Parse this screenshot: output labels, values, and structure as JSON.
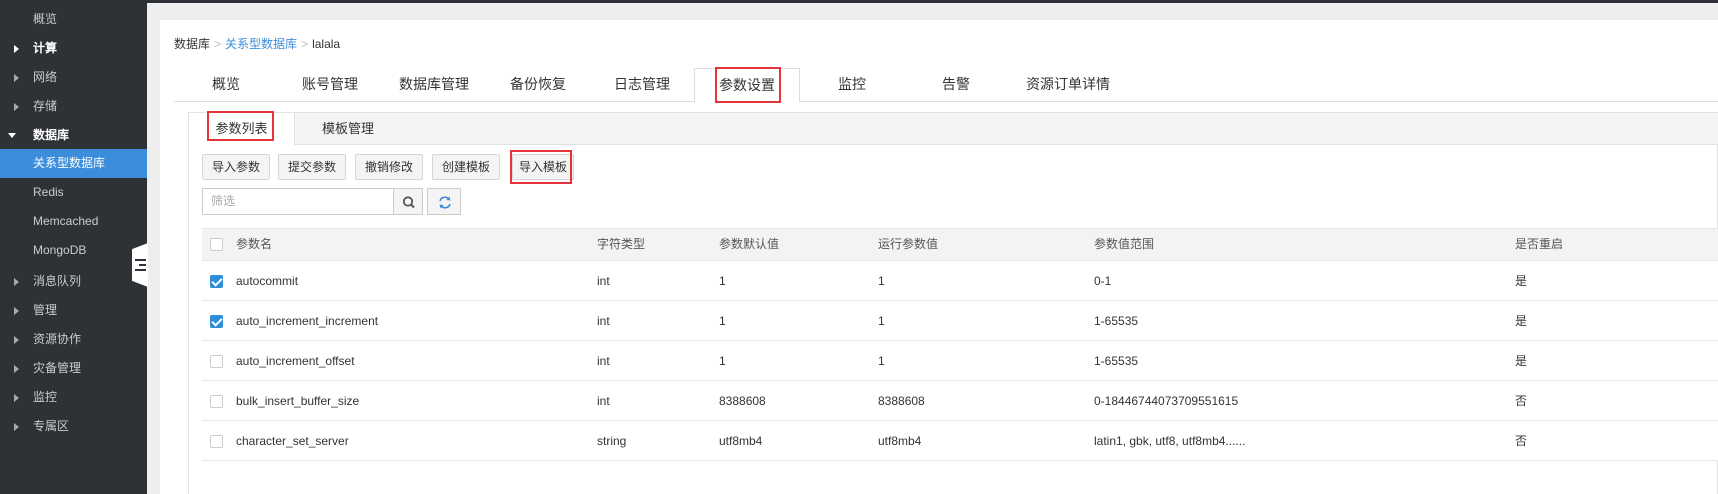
{
  "sidebar": {
    "items": [
      {
        "label": "概览"
      },
      {
        "label": "计算"
      },
      {
        "label": "网络"
      },
      {
        "label": "存储"
      },
      {
        "label": "数据库"
      },
      {
        "label": "关系型数据库"
      },
      {
        "label": "Redis"
      },
      {
        "label": "Memcached"
      },
      {
        "label": "MongoDB"
      },
      {
        "label": "消息队列"
      },
      {
        "label": "管理"
      },
      {
        "label": "资源协作"
      },
      {
        "label": "灾备管理"
      },
      {
        "label": "监控"
      },
      {
        "label": "专属区"
      }
    ]
  },
  "breadcrumb": {
    "root": "数据库",
    "section": "关系型数据库",
    "current": "lalala",
    "separator": ">"
  },
  "tabs": [
    {
      "label": "概览"
    },
    {
      "label": "账号管理"
    },
    {
      "label": "数据库管理"
    },
    {
      "label": "备份恢复"
    },
    {
      "label": "日志管理"
    },
    {
      "label": "参数设置"
    },
    {
      "label": "监控"
    },
    {
      "label": "告警"
    },
    {
      "label": "资源订单详情"
    }
  ],
  "subtabs": [
    {
      "label": "参数列表"
    },
    {
      "label": "模板管理"
    }
  ],
  "toolbar": {
    "import_params": "导入参数",
    "submit_params": "提交参数",
    "revert_changes": "撤销修改",
    "create_template": "创建模板",
    "import_template": "导入模板"
  },
  "search": {
    "placeholder": "筛选"
  },
  "table": {
    "headers": [
      "参数名",
      "字符类型",
      "参数默认值",
      "运行参数值",
      "参数值范围",
      "是否重启"
    ],
    "rows": [
      {
        "checked": true,
        "name": "autocommit",
        "type": "int",
        "default": "1",
        "running": "1",
        "range": "0-1",
        "restart": "是"
      },
      {
        "checked": true,
        "name": "auto_increment_increment",
        "type": "int",
        "default": "1",
        "running": "1",
        "range": "1-65535",
        "restart": "是"
      },
      {
        "checked": false,
        "name": "auto_increment_offset",
        "type": "int",
        "default": "1",
        "running": "1",
        "range": "1-65535",
        "restart": "是"
      },
      {
        "checked": false,
        "name": "bulk_insert_buffer_size",
        "type": "int",
        "default": "8388608",
        "running": "8388608",
        "range": "0-18446744073709551615",
        "restart": "否"
      },
      {
        "checked": false,
        "name": "character_set_server",
        "type": "string",
        "default": "utf8mb4",
        "running": "utf8mb4",
        "range": "latin1, gbk, utf8, utf8mb4......",
        "restart": "否"
      }
    ]
  },
  "colors": {
    "sidebar_bg": "#2e3236",
    "active_blue": "#3c8ddb",
    "highlight_red": "#e5343b",
    "checkbox_blue": "#2b8fd9"
  }
}
